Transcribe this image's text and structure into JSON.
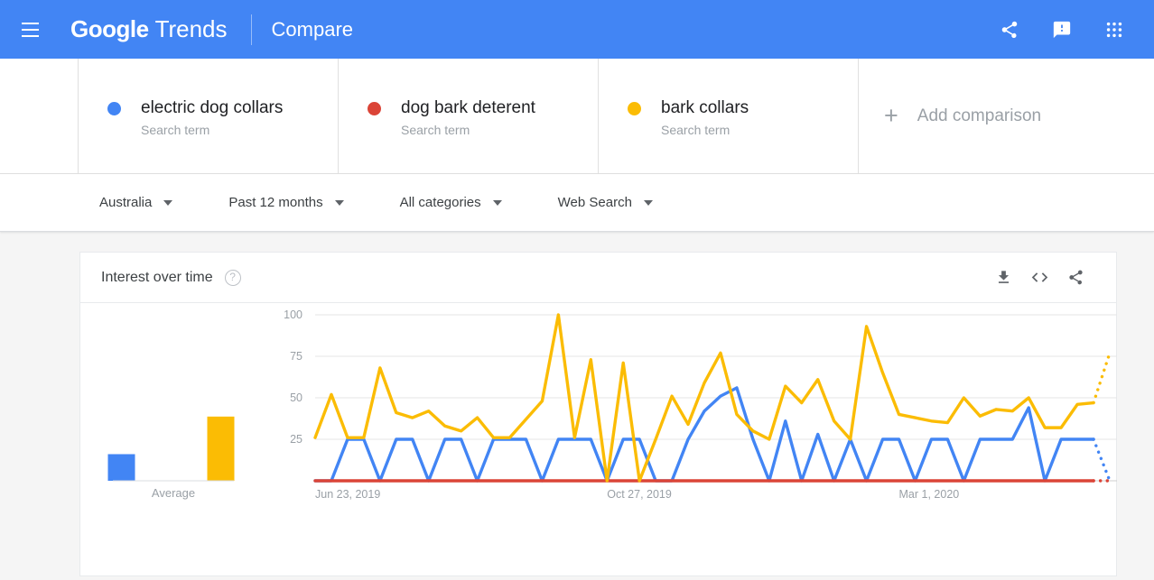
{
  "appbar": {
    "menu_icon": "hamburger-menu-icon",
    "brand_google": "Google",
    "brand_product": "Trends",
    "page_title": "Compare",
    "actions": [
      {
        "name": "share-icon",
        "label": "Share"
      },
      {
        "name": "feedback-icon",
        "label": "Send feedback"
      },
      {
        "name": "apps-grid-icon",
        "label": "Google apps"
      }
    ],
    "background": "#4285f4"
  },
  "compare": {
    "terms": [
      {
        "name": "electric dog collars",
        "type": "Search term",
        "color": "#4285f4"
      },
      {
        "name": "dog bark deterent",
        "type": "Search term",
        "color": "#db4437"
      },
      {
        "name": "bark collars",
        "type": "Search term",
        "color": "#fbbc04"
      }
    ],
    "add": {
      "plus": "+",
      "label": "Add comparison"
    }
  },
  "filters": [
    {
      "name": "location-filter",
      "label": "Australia"
    },
    {
      "name": "time-range-filter",
      "label": "Past 12 months"
    },
    {
      "name": "category-filter",
      "label": "All categories"
    },
    {
      "name": "search-type-filter",
      "label": "Web Search"
    }
  ],
  "card": {
    "title": "Interest over time",
    "help": "?",
    "actions": [
      {
        "name": "download-csv-icon",
        "label": "Download CSV"
      },
      {
        "name": "embed-code-icon",
        "label": "Embed"
      },
      {
        "name": "share-chart-icon",
        "label": "Share"
      }
    ]
  },
  "chart_data": {
    "type": "line",
    "title": "Interest over time",
    "xlabel": "",
    "ylabel": "",
    "ylim": [
      0,
      100
    ],
    "yticks": [
      25,
      50,
      75,
      100
    ],
    "grid": true,
    "legend": "top",
    "x_tick_labels": [
      "Jun 23, 2019",
      "Oct 27, 2019",
      "Mar 1, 2020"
    ],
    "x_tick_indices": [
      0,
      18,
      36
    ],
    "partial_last_segment": true,
    "series": [
      {
        "name": "electric dog collars",
        "color": "#4285f4",
        "values": [
          0,
          0,
          25,
          25,
          0,
          25,
          25,
          0,
          25,
          25,
          0,
          25,
          25,
          25,
          0,
          25,
          25,
          25,
          0,
          25,
          25,
          0,
          0,
          25,
          42,
          51,
          56,
          25,
          0,
          36,
          0,
          28,
          0,
          25,
          0,
          25,
          25,
          0,
          25,
          25,
          0,
          25,
          25,
          25,
          44,
          0,
          25,
          25,
          25,
          0
        ]
      },
      {
        "name": "dog bark deterent",
        "color": "#db4437",
        "values": [
          0,
          0,
          0,
          0,
          0,
          0,
          0,
          0,
          0,
          0,
          0,
          0,
          0,
          0,
          0,
          0,
          0,
          0,
          0,
          0,
          0,
          0,
          0,
          0,
          0,
          0,
          0,
          0,
          0,
          0,
          0,
          0,
          0,
          0,
          0,
          0,
          0,
          0,
          0,
          0,
          0,
          0,
          0,
          0,
          0,
          0,
          0,
          0,
          0,
          0
        ]
      },
      {
        "name": "bark collars",
        "color": "#fbbc04",
        "values": [
          26,
          52,
          26,
          26,
          68,
          41,
          38,
          42,
          33,
          30,
          38,
          26,
          26,
          37,
          48,
          100,
          26,
          73,
          0,
          71,
          0,
          25,
          51,
          34,
          59,
          77,
          40,
          30,
          25,
          57,
          47,
          61,
          36,
          25,
          93,
          65,
          40,
          38,
          36,
          35,
          50,
          39,
          43,
          42,
          50,
          32,
          32,
          46,
          47,
          77
        ]
      }
    ],
    "average_bars": {
      "label": "Average",
      "values": [
        17,
        0,
        41
      ],
      "colors": [
        "#4285f4",
        "#db4437",
        "#fbbc04"
      ]
    }
  }
}
